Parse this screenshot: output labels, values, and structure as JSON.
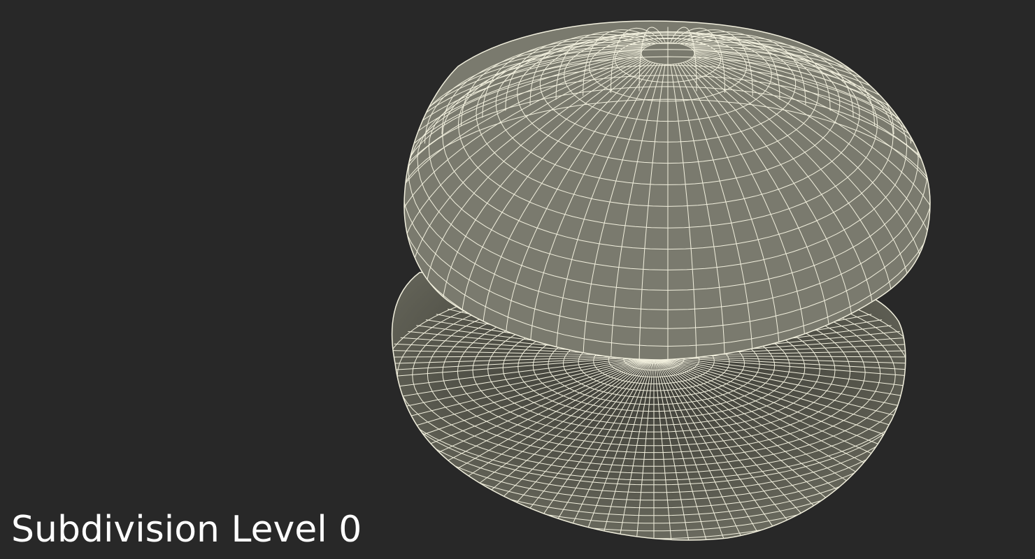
{
  "caption": "Subdivision Level 0",
  "colors": {
    "background": "#282828",
    "mesh_fill": "#7a7a6e",
    "mesh_fill_dark": "#5e5e54",
    "wireframe": "#f2f0de",
    "caption_text": "#ffffff"
  }
}
